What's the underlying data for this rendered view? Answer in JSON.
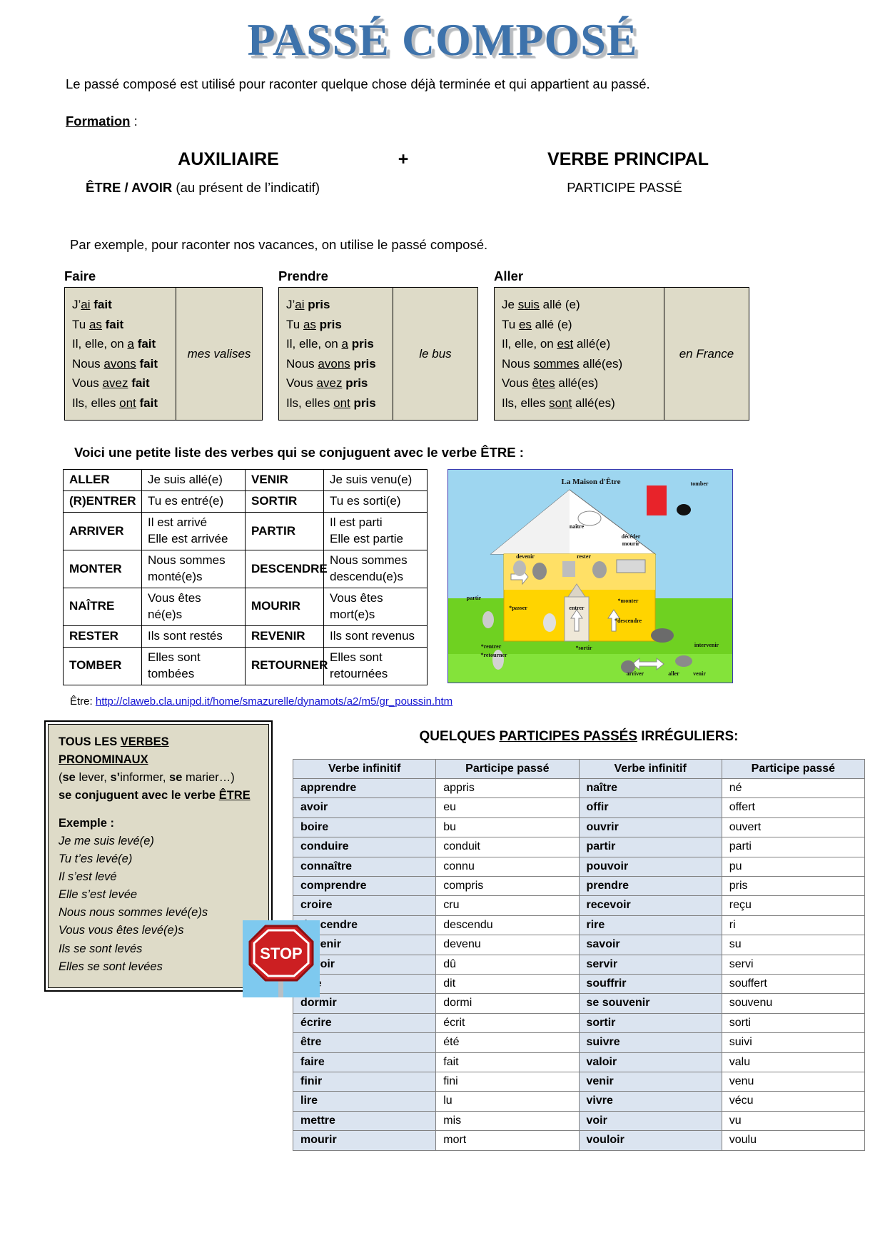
{
  "title": "PASSÉ COMPOSÉ",
  "intro": "Le passé composé est utilisé pour raconter quelque chose déjà terminée et qui appartient au passé.",
  "formation": {
    "label": "Formation",
    "colon": " :",
    "auxiliaire": "AUXILIAIRE",
    "plus": "+",
    "verbe_principal": "VERBE PRINCIPAL",
    "aux_detail_bold": "ÊTRE / AVOIR",
    "aux_detail_rest": " (au présent de l’indicatif)",
    "participe_passe": "PARTICIPE PASSÉ"
  },
  "example_intro": "Par exemple, pour raconter nos vacances, on utilise le passé composé.",
  "conjugations": [
    {
      "verb": "Faire",
      "complement": "mes valises",
      "lines": [
        {
          "pre": "J’",
          "aux": "ai",
          "part": " fait"
        },
        {
          "pre": "Tu ",
          "aux": "as",
          "part": " fait"
        },
        {
          "pre": "Il, elle, on ",
          "aux": "a",
          "part": " fait"
        },
        {
          "pre": "Nous ",
          "aux": "avons",
          "part": " fait"
        },
        {
          "pre": "Vous ",
          "aux": "avez",
          "part": " fait"
        },
        {
          "pre": "Ils, elles ",
          "aux": "ont",
          "part": " fait"
        }
      ]
    },
    {
      "verb": "Prendre",
      "complement": "le bus",
      "lines": [
        {
          "pre": "J’",
          "aux": "ai",
          "part": " pris"
        },
        {
          "pre": "Tu ",
          "aux": "as",
          "part": "  pris"
        },
        {
          "pre": "Il, elle, on ",
          "aux": "a",
          "part": "  pris"
        },
        {
          "pre": "Nous ",
          "aux": "avons",
          "part": "  pris"
        },
        {
          "pre": "Vous ",
          "aux": "avez",
          "part": "  pris"
        },
        {
          "pre": "Ils, elles ",
          "aux": "ont",
          "part": "  pris"
        }
      ]
    },
    {
      "verb": "Aller",
      "complement": "en France",
      "lines": [
        {
          "pre": "Je ",
          "aux": "suis",
          "part": " allé (e)"
        },
        {
          "pre": "Tu ",
          "aux": "es",
          "part": "  allé (e)"
        },
        {
          "pre": "Il, elle, on ",
          "aux": "est",
          "part": "  allé(e)"
        },
        {
          "pre": "Nous ",
          "aux": "sommes",
          "part": "  allé(es)"
        },
        {
          "pre": "Vous ",
          "aux": "êtes",
          "part": "  allé(es)"
        },
        {
          "pre": "Ils, elles ",
          "aux": "sont",
          "part": "  allé(es)"
        }
      ]
    }
  ],
  "etre_heading": "Voici une petite liste des verbes qui se conjuguent avec le verbe ÊTRE :",
  "etre_table": [
    {
      "v1": "ALLER",
      "c1": "Je suis allé(e)",
      "v2": "VENIR",
      "c2": "Je suis venu(e)"
    },
    {
      "v1": "(R)ENTRER",
      "c1": "Tu es entré(e)",
      "v2": "SORTIR",
      "c2": "Tu es sorti(e)"
    },
    {
      "v1": "ARRIVER",
      "c1": "Il est arrivé\nElle est arrivée",
      "v2": "PARTIR",
      "c2": "Il est parti\nElle est partie"
    },
    {
      "v1": "MONTER",
      "c1": "Nous sommes\nmonté(e)s",
      "v2": "DESCENDRE",
      "c2": "Nous sommes\ndescendu(e)s"
    },
    {
      "v1": "NAÎTRE",
      "c1": "Vous êtes\nné(e)s",
      "v2": "MOURIR",
      "c2": "Vous êtes\nmort(e)s"
    },
    {
      "v1": "RESTER",
      "c1": "Ils sont restés",
      "v2": "REVENIR",
      "c2": "Ils sont revenus"
    },
    {
      "v1": "TOMBER",
      "c1": "Elles sont\ntombées",
      "v2": "RETOURNER",
      "c2": "Elles sont\nretournées"
    }
  ],
  "maison": {
    "caption": "La Maison d'Être",
    "labels": [
      "tomber",
      "naître",
      "décéder",
      "mourir",
      "devenir",
      "rester",
      "partir",
      "passer",
      "monter",
      "descendre",
      "entrer",
      "rentrer",
      "retourner",
      "sortir",
      "arriver",
      "aller",
      "venir",
      "intervenir"
    ]
  },
  "source": {
    "prefix": "Être: ",
    "url": "http://claweb.cla.unipd.it/home/smazurelle/dynamots/a2/m5/gr_poussin.htm"
  },
  "pronominal": {
    "line1_a": "TOUS LES ",
    "line1_b": "VERBES PRONOMINAUX",
    "line2": "(se lever, s’informer, se marier…)",
    "line3_a": "se conjuguent avec le verbe ",
    "line3_b": "ÊTRE",
    "exemple_label": "Exemple :",
    "examples": [
      "Je me suis levé(e)",
      "Tu t’es levé(e)",
      "Il s’est levé",
      "Elle s’est levée",
      "Nous nous sommes levé(e)s",
      "Vous vous êtes levé(e)s",
      "Ils se sont levés",
      "Elles se sont levées"
    ],
    "stop_label": "STOP"
  },
  "irregular": {
    "title_a": "QUELQUES ",
    "title_b": "PARTICIPES PASSÉS",
    "title_c": " IRRÉGULIERS:",
    "headers": [
      "Verbe infinitif",
      "Participe passé",
      "Verbe infinitif",
      "Participe passé"
    ],
    "rows": [
      {
        "inf1": "apprendre",
        "pp1": "appris",
        "inf2": "naître",
        "pp2": "né"
      },
      {
        "inf1": "avoir",
        "pp1": "eu",
        "inf2": "offir",
        "pp2": "offert"
      },
      {
        "inf1": "boire",
        "pp1": "bu",
        "inf2": "ouvrir",
        "pp2": "ouvert"
      },
      {
        "inf1": "conduire",
        "pp1": "conduit",
        "inf2": "partir",
        "pp2": "parti"
      },
      {
        "inf1": "connaître",
        "pp1": "connu",
        "inf2": "pouvoir",
        "pp2": "pu"
      },
      {
        "inf1": "comprendre",
        "pp1": "compris",
        "inf2": "prendre",
        "pp2": "pris"
      },
      {
        "inf1": "croire",
        "pp1": "cru",
        "inf2": "recevoir",
        "pp2": "reçu"
      },
      {
        "inf1": "descendre",
        "pp1": "descendu",
        "inf2": "rire",
        "pp2": "ri"
      },
      {
        "inf1": "devenir",
        "pp1": "devenu",
        "inf2": "savoir",
        "pp2": "su"
      },
      {
        "inf1": "devoir",
        "pp1": "dû",
        "inf2": "servir",
        "pp2": "servi"
      },
      {
        "inf1": "dire",
        "pp1": "dit",
        "inf2": "souffrir",
        "pp2": "souffert"
      },
      {
        "inf1": "dormir",
        "pp1": "dormi",
        "inf2": "se souvenir",
        "pp2": "souvenu"
      },
      {
        "inf1": "écrire",
        "pp1": "écrit",
        "inf2": "sortir",
        "pp2": "sorti"
      },
      {
        "inf1": "être",
        "pp1": "été",
        "inf2": "suivre",
        "pp2": "suivi"
      },
      {
        "inf1": "faire",
        "pp1": "fait",
        "inf2": "valoir",
        "pp2": "valu"
      },
      {
        "inf1": "finir",
        "pp1": "fini",
        "inf2": "venir",
        "pp2": "venu"
      },
      {
        "inf1": "lire",
        "pp1": "lu",
        "inf2": "vivre",
        "pp2": "vécu"
      },
      {
        "inf1": "mettre",
        "pp1": "mis",
        "inf2": "voir",
        "pp2": "vu"
      },
      {
        "inf1": "mourir",
        "pp1": "mort",
        "inf2": "vouloir",
        "pp2": "voulu"
      }
    ]
  },
  "colors": {
    "title_blue": "#3d72ab",
    "box_beige": "#dedbc8",
    "table_blue": "#dbe4f0",
    "link_blue": "#1414d2",
    "stop_red": "#cc1f22"
  }
}
